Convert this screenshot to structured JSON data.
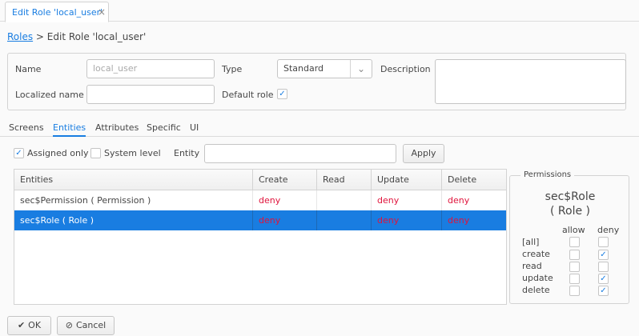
{
  "tab": {
    "title": "Edit Role 'local_user'",
    "close": "×"
  },
  "breadcrumb": {
    "link": "Roles",
    "rest": " > Edit Role 'local_user'"
  },
  "form": {
    "name_label": "Name",
    "name_value": "local_user",
    "type_label": "Type",
    "type_value": "Standard",
    "description_label": "Description",
    "localized_label": "Localized name",
    "default_role_label": "Default role"
  },
  "subtabs": [
    "Screens",
    "Entities",
    "Attributes",
    "Specific",
    "UI"
  ],
  "filters": {
    "assigned_only": "Assigned only",
    "system_level": "System level",
    "entity_label": "Entity",
    "apply": "Apply"
  },
  "table": {
    "headers": [
      "Entities",
      "Create",
      "Read",
      "Update",
      "Delete"
    ],
    "rows": [
      [
        "sec$Permission ( Permission )",
        "deny",
        "",
        "deny",
        "deny"
      ],
      [
        "sec$Role ( Role )",
        "deny",
        "",
        "deny",
        "deny"
      ]
    ]
  },
  "permissions": {
    "legend": "Permissions",
    "entity": "sec$Role",
    "entity_caption": "( Role )",
    "allow": "allow",
    "deny": "deny",
    "rows": [
      {
        "label": "[all]",
        "allow": false,
        "deny": false
      },
      {
        "label": "create",
        "allow": false,
        "deny": true
      },
      {
        "label": "read",
        "allow": false,
        "deny": false
      },
      {
        "label": "update",
        "allow": false,
        "deny": true
      },
      {
        "label": "delete",
        "allow": false,
        "deny": true
      }
    ]
  },
  "buttons": {
    "ok": "OK",
    "cancel": "Cancel"
  },
  "colors": {
    "accent": "#197de1",
    "deny": "#e0143c"
  },
  "icons": {
    "ok": "check-icon",
    "cancel": "cancel-circle-icon",
    "select": "chevron-down-icon",
    "close": "close-icon"
  }
}
